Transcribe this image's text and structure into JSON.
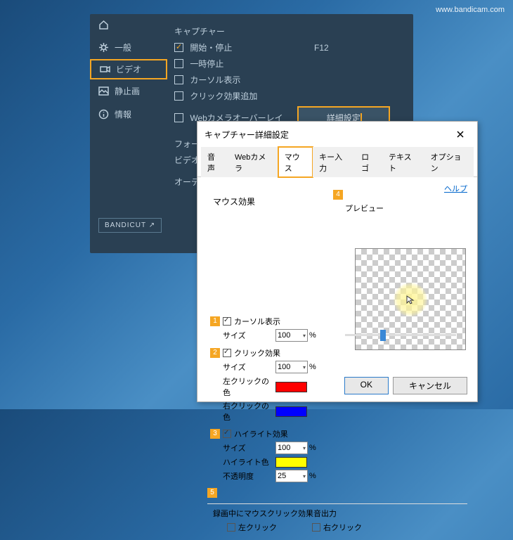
{
  "watermark": "www.bandicam.com",
  "sidebar": {
    "general": "一般",
    "video": "ビデオ",
    "image": "静止画",
    "info": "情報"
  },
  "bg": {
    "capture": "キャプチャー",
    "startstop": "開始・停止",
    "startkey": "F12",
    "pause": "一時停止",
    "cursor": "カーソル表示",
    "click_add": "クリック効果追加",
    "webcam": "Webカメラオーバーレイ",
    "advanced": "詳細設定",
    "format": "フォー",
    "video": "ビデオ",
    "audio": "オーデ"
  },
  "bandicut": "BANDICUT  ↗",
  "dialog": {
    "title": "キャプチャー詳細設定",
    "tabs": {
      "audio": "音声",
      "webcam": "Webカメラ",
      "mouse": "マウス",
      "key": "キー入力",
      "logo": "ロゴ",
      "text": "テキスト",
      "option": "オプション"
    },
    "help": "ヘルプ",
    "effects": "マウス効果",
    "preview": "プレビュー",
    "cursor": "カーソル表示",
    "size": "サイズ",
    "click": "クリック効果",
    "leftcolor": "左クリックの色",
    "rightcolor": "右クリックの色",
    "highlight": "ハイライト効果",
    "hilite_color": "ハイライト色",
    "opacity": "不透明度",
    "v100": "100",
    "v25": "25",
    "pct": "%",
    "colors": {
      "left": "#ff0000",
      "right": "#0000ff",
      "hi": "#ffff00"
    },
    "sound_out": "録画中にマウスクリック効果音出力",
    "leftclick": "左クリック",
    "rightclick": "右クリック",
    "ok": "OK",
    "cancel": "キャンセル"
  },
  "markers": {
    "n1": "1",
    "n2": "2",
    "n3": "3",
    "n4": "4",
    "n5": "5"
  }
}
